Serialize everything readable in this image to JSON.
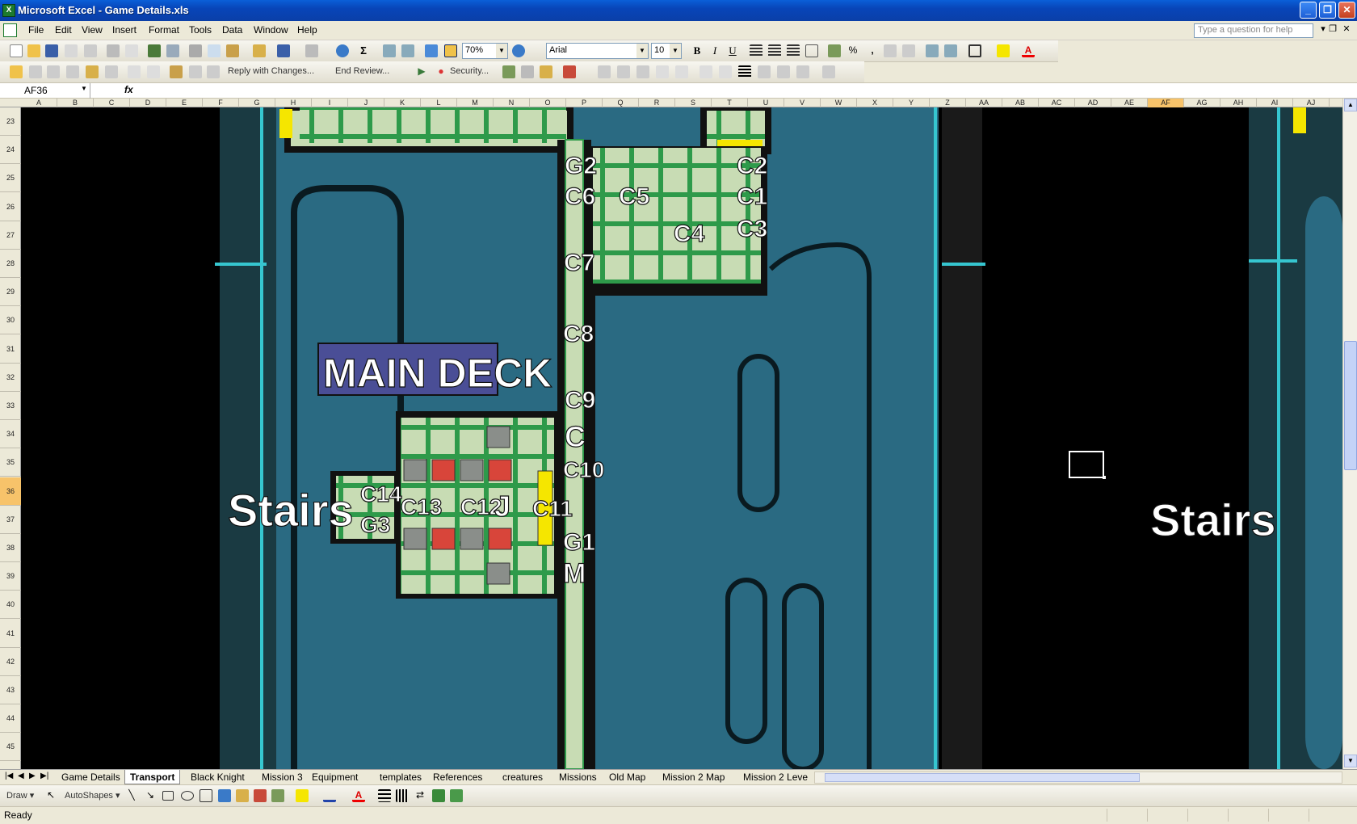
{
  "window": {
    "title": "Microsoft Excel - Game Details.xls",
    "app_icon": "excel-icon",
    "buttons": {
      "minimize": "_",
      "restore": "❐",
      "close": "✕"
    }
  },
  "menubar": {
    "items": [
      "File",
      "Edit",
      "View",
      "Insert",
      "Format",
      "Tools",
      "Data",
      "Window",
      "Help"
    ],
    "help_placeholder": "Type a question for help"
  },
  "toolbar": {
    "zoom": "70%",
    "font": "Arial",
    "font_size": "10",
    "bold": "B",
    "italic": "I",
    "underline": "U",
    "percent": "%",
    "comma": ",",
    "reply_with_changes": "Reply with Changes...",
    "end_review": "End Review...",
    "security": "Security..."
  },
  "formula_bar": {
    "name_box": "AF36",
    "fx": "fx",
    "value": ""
  },
  "columns": [
    "A",
    "B",
    "C",
    "D",
    "E",
    "F",
    "G",
    "H",
    "I",
    "J",
    "K",
    "L",
    "M",
    "N",
    "O",
    "P",
    "Q",
    "R",
    "S",
    "T",
    "U",
    "V",
    "W",
    "X",
    "Y",
    "Z",
    "AA",
    "AB",
    "AC",
    "AD",
    "AE",
    "AF",
    "AG",
    "AH",
    "AI",
    "AJ"
  ],
  "active_column": "AF",
  "rows": [
    "23",
    "24",
    "25",
    "26",
    "27",
    "28",
    "29",
    "30",
    "31",
    "32",
    "33",
    "34",
    "35",
    "36",
    "37",
    "38",
    "39",
    "40",
    "41",
    "42",
    "43",
    "44",
    "45"
  ],
  "active_row": "36",
  "map": {
    "title": "MAIN DECK",
    "stairs_left": "Stairs",
    "stairs_right": "Stairs",
    "labels": [
      "G2",
      "C6",
      "C5",
      "C2",
      "C1",
      "C3",
      "C4",
      "C7",
      "C8",
      "C9",
      "C",
      "C10",
      "C11",
      "C14",
      "G3",
      "C13",
      "C12",
      "J",
      "G1",
      "M"
    ],
    "colors": {
      "water": "#2a6a82",
      "floor": "#c8dcb4",
      "wall": "#1e1e1e",
      "red_tile": "#d8453a",
      "grey_tile": "#8a8e8a",
      "yellow": "#f5e600",
      "cyan_line": "#36c6d0"
    }
  },
  "sheet_tabs": [
    "Game Details",
    "Transport",
    "Black Knight",
    "Mission 3",
    "Equipment",
    "templates",
    "References",
    "creatures",
    "Missions",
    "Old Map",
    "Mission 2 Map",
    "Mission 2 Leve"
  ],
  "active_tab": "Transport",
  "drawbar": {
    "draw": "Draw",
    "autoshapes": "AutoShapes"
  },
  "status": {
    "text": "Ready"
  }
}
